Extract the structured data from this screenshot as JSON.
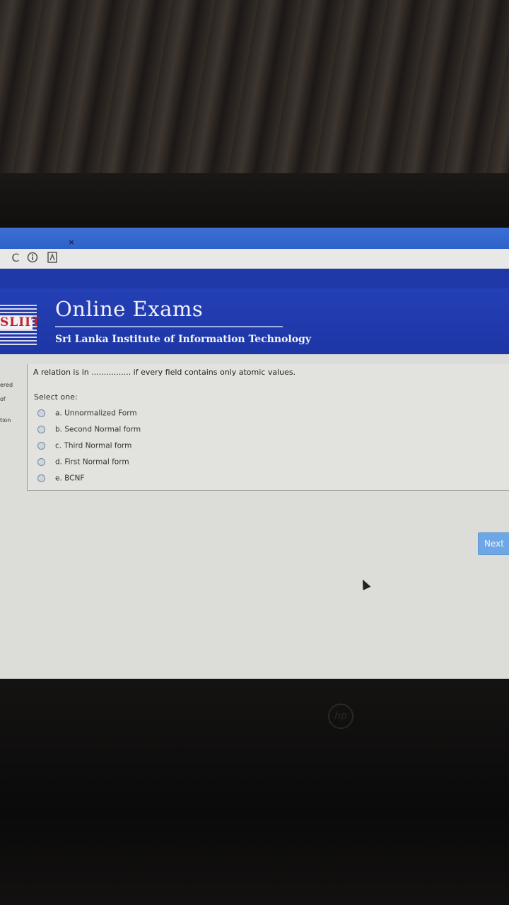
{
  "browser": {
    "tab_close": "×",
    "refresh_icon": "refresh-icon",
    "info_icon": "info-icon",
    "extension_icon": "extension-icon"
  },
  "header": {
    "logo_text": "SLIIT",
    "title": "Online Exams",
    "subtitle": "Sri Lanka Institute of Information Technology"
  },
  "sidebar_fragments": [
    "ered",
    "of",
    "tion"
  ],
  "question": {
    "text": "A relation is in ................ if every field contains only atomic values.",
    "select_prompt": "Select one:",
    "options": [
      {
        "label": "a. Unnormalized Form"
      },
      {
        "label": "b. Second Normal form"
      },
      {
        "label": "c. Third Normal form"
      },
      {
        "label": "d. First Normal form"
      },
      {
        "label": "e. BCNF"
      }
    ]
  },
  "footer": {
    "next_label": "Next"
  },
  "colors": {
    "header_blue": "#1f3aa8",
    "next_button": "#6ea7e6",
    "logo_red": "#c8202a"
  }
}
